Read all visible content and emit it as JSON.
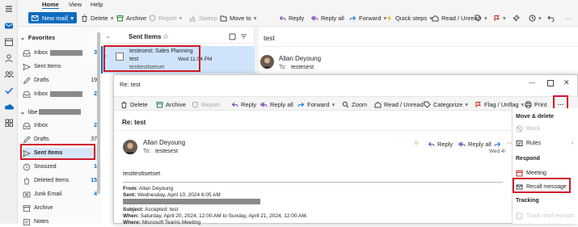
{
  "menubar": {
    "tabs": [
      "Home",
      "View",
      "Help"
    ]
  },
  "ribbon": {
    "new_mail": "New mail",
    "buttons": [
      "Delete",
      "Archive",
      "Report",
      "Sweep",
      "Move to",
      "Reply",
      "Reply all",
      "Forward",
      "Quick steps",
      "Read / Unread"
    ]
  },
  "folders": {
    "favorites_header": "Favorites",
    "favorites": [
      {
        "label": "Inbox",
        "count": "3"
      },
      {
        "label": "Sent Items",
        "count": ""
      },
      {
        "label": "Drafts",
        "count": "19"
      },
      {
        "label": "Inbox",
        "count": "2"
      }
    ],
    "account_header": "libe",
    "items": [
      {
        "label": "Inbox",
        "count": "2"
      },
      {
        "label": "Drafts",
        "count": "37"
      },
      {
        "label": "Sent Items",
        "count": ""
      },
      {
        "label": "Snoozed",
        "count": "1"
      },
      {
        "label": "Deleted Items",
        "count": "15"
      },
      {
        "label": "Junk Email",
        "count": "4"
      },
      {
        "label": "Archive",
        "count": ""
      },
      {
        "label": "Notes",
        "count": ""
      }
    ]
  },
  "message_list": {
    "title": "Sent Items",
    "item": {
      "recipient": "testesest; Sales Planning",
      "subject": "test",
      "preview": "testtesttsetset",
      "time": "Wed 11:04 PM"
    }
  },
  "reading_pane": {
    "subject": "test",
    "sender": "Allan Deyoung",
    "to_label": "To:",
    "to": "testesest"
  },
  "popup": {
    "window_title": "Re: test",
    "toolbar": [
      "Delete",
      "Archive",
      "Report",
      "Reply",
      "Reply all",
      "Forward",
      "Zoom",
      "Read / Unread",
      "Categorize",
      "Flag / Unflag",
      "Print"
    ],
    "subject": "Re: test",
    "sender": "Allan Deyoung",
    "to_label": "To:",
    "to": "testesest",
    "date": "Wed 4/",
    "actions": [
      "Reply",
      "Reply all",
      "Forward"
    ],
    "body_first_line": "testtesttsetset",
    "quoted": {
      "from_label": "From:",
      "from": "Allan Deyoung",
      "sent_label": "Sent:",
      "sent": "Wednesday, April 10, 2024 6:05 AM",
      "subject_label": "Subject:",
      "subject": "Accepted: test",
      "when_label": "When:",
      "when": "Saturday, April 20, 2024, 12:00 AM to Sunday, April 21, 2024, 12:00 AM.",
      "where_label": "Where:",
      "where": "Microsoft Teams Meeting"
    }
  },
  "more_menu": {
    "section_move": "Move & delete",
    "block": "Block",
    "rules": "Rules",
    "section_respond": "Respond",
    "meeting": "Meeting",
    "recall": "Recall message",
    "section_tracking": "Tracking",
    "track": "Track read receipts"
  },
  "colors": {
    "accent": "#0f6cbd",
    "highlight": "#d21a2a",
    "selected_bg": "#cfe4fa"
  }
}
